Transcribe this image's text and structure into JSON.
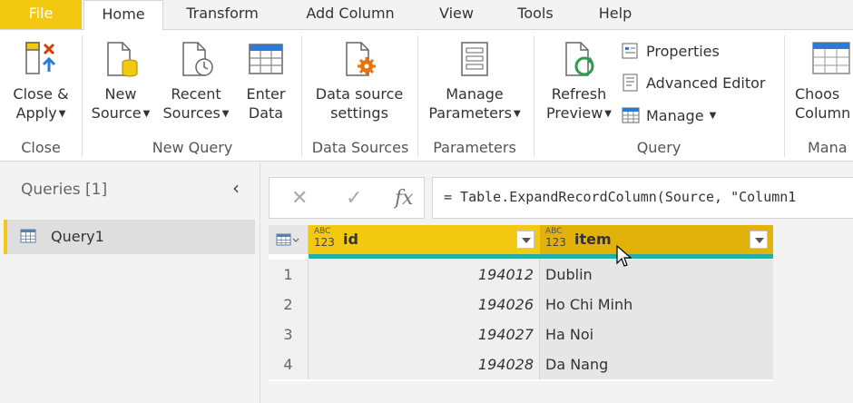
{
  "tabs": [
    {
      "label": "File"
    },
    {
      "label": "Home"
    },
    {
      "label": "Transform"
    },
    {
      "label": "Add Column"
    },
    {
      "label": "View"
    },
    {
      "label": "Tools"
    },
    {
      "label": "Help"
    }
  ],
  "ribbon": {
    "close_apply": {
      "line1": "Close &",
      "line2": "Apply"
    },
    "new_source": {
      "line1": "New",
      "line2": "Source"
    },
    "recent_sources": {
      "line1": "Recent",
      "line2": "Sources"
    },
    "enter_data": {
      "line1": "Enter",
      "line2": "Data"
    },
    "data_source_settings": {
      "line1": "Data source",
      "line2": "settings"
    },
    "manage_parameters": {
      "line1": "Manage",
      "line2": "Parameters"
    },
    "refresh_preview": {
      "line1": "Refresh",
      "line2": "Preview"
    },
    "properties": "Properties",
    "advanced_editor": "Advanced Editor",
    "manage": "Manage",
    "choose_columns": {
      "line1": "Choos",
      "line2": "Column"
    },
    "groups": {
      "close": "Close",
      "new_query": "New Query",
      "data_sources": "Data Sources",
      "parameters": "Parameters",
      "query": "Query",
      "manage": "Mana"
    }
  },
  "queries_pane": {
    "title": "Queries [1]",
    "items": [
      {
        "label": "Query1"
      }
    ]
  },
  "formula_bar": {
    "cancel": "✕",
    "commit": "✓",
    "fx": "fx",
    "formula": "= Table.ExpandRecordColumn(Source, \"Column1"
  },
  "table": {
    "columns": [
      {
        "name": "id",
        "type_top": "ABC",
        "type_bottom": "123"
      },
      {
        "name": "item",
        "type_top": "ABC",
        "type_bottom": "123"
      }
    ],
    "rows": [
      {
        "n": "1",
        "id": "194012",
        "item": "Dublin"
      },
      {
        "n": "2",
        "id": "194026",
        "item": "Ho Chi Minh"
      },
      {
        "n": "3",
        "id": "194027",
        "item": "Ha Noi"
      },
      {
        "n": "4",
        "id": "194028",
        "item": "Da Nang"
      }
    ]
  },
  "colors": {
    "accent": "#f2c811",
    "selected_header": "#e1b209",
    "quality_bar": "#1fb1a6"
  }
}
